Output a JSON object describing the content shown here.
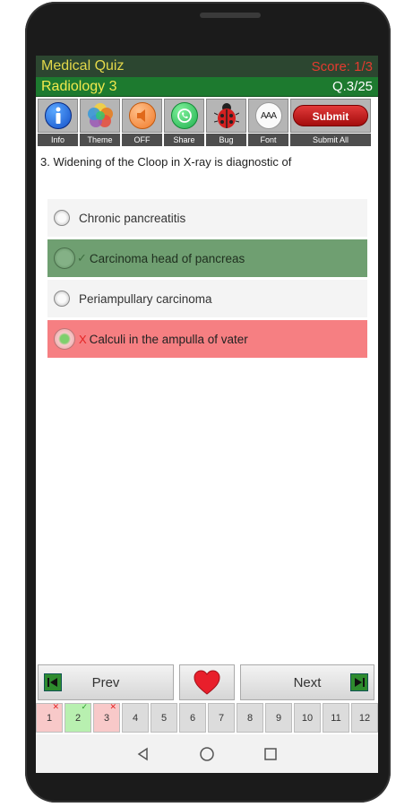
{
  "header": {
    "app_title": "Medical Quiz",
    "score": "Score: 1/3",
    "subject": "Radiology 3",
    "question_index": "Q.3/25"
  },
  "toolbar": {
    "items": [
      {
        "label": "Info",
        "icon": "info-icon"
      },
      {
        "label": "Theme",
        "icon": "theme-icon"
      },
      {
        "label": "OFF",
        "icon": "speaker-icon"
      },
      {
        "label": "Share",
        "icon": "whatsapp-icon"
      },
      {
        "label": "Bug",
        "icon": "ladybug-icon"
      },
      {
        "label": "Font",
        "icon": "font-size-icon"
      }
    ],
    "submit_button": "Submit",
    "submit_all_label": "Submit All",
    "font_icon_text": "AAA"
  },
  "question": {
    "text": "3. Widening of the Cloop in X-ray is diagnostic of"
  },
  "options": [
    {
      "text": "Chronic pancreatitis",
      "state": "normal",
      "mark": ""
    },
    {
      "text": "Carcinoma head of pancreas",
      "state": "correct",
      "mark": "✓"
    },
    {
      "text": "Periampullary carcinoma",
      "state": "normal",
      "mark": ""
    },
    {
      "text": "Calculi in the ampulla of vater",
      "state": "wrong",
      "mark": "X"
    }
  ],
  "nav": {
    "prev_label": "Prev",
    "next_label": "Next",
    "favorite_icon": "heart-icon"
  },
  "pages": [
    {
      "n": "1",
      "status": "x",
      "mark": "✕"
    },
    {
      "n": "2",
      "status": "ok",
      "mark": "✓"
    },
    {
      "n": "3",
      "status": "x",
      "mark": "✕"
    },
    {
      "n": "4",
      "status": "",
      "mark": ""
    },
    {
      "n": "5",
      "status": "",
      "mark": ""
    },
    {
      "n": "6",
      "status": "",
      "mark": ""
    },
    {
      "n": "7",
      "status": "",
      "mark": ""
    },
    {
      "n": "8",
      "status": "",
      "mark": ""
    },
    {
      "n": "9",
      "status": "",
      "mark": ""
    },
    {
      "n": "10",
      "status": "",
      "mark": ""
    },
    {
      "n": "11",
      "status": "",
      "mark": ""
    },
    {
      "n": "12",
      "status": "",
      "mark": ""
    }
  ],
  "colors": {
    "header_dark": "#2c4630",
    "header_green": "#1d7a2f",
    "title_yellow": "#e3d84a",
    "score_red": "#e53a2f",
    "correct_bg": "#6f9f71",
    "wrong_bg": "#f67f82"
  }
}
